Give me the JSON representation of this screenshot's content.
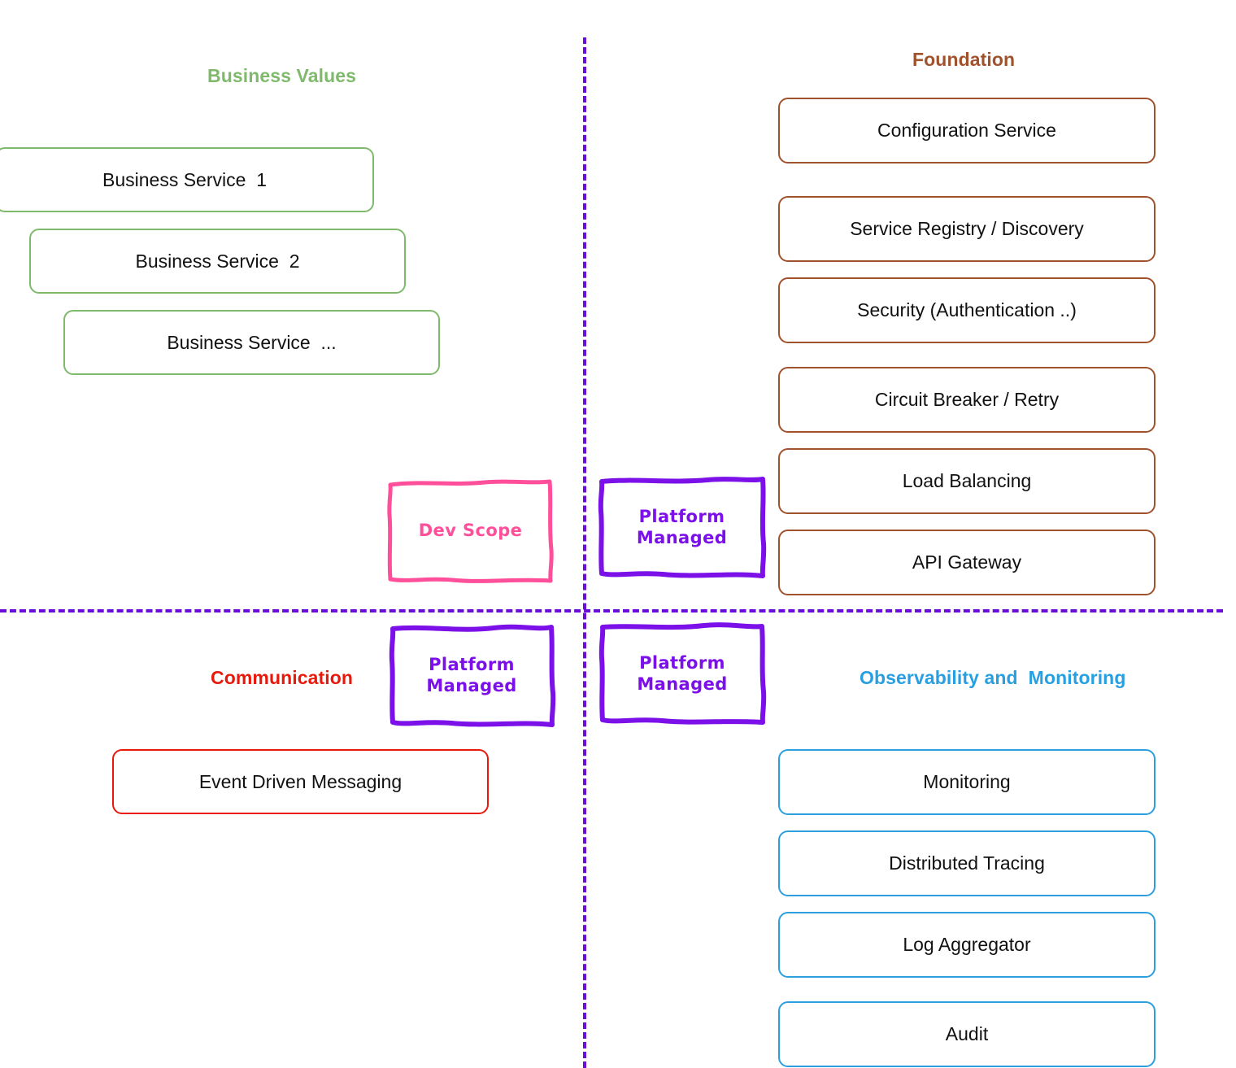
{
  "diagram": {
    "title_business_values": "Business Values",
    "title_foundation": "Foundation",
    "title_communication": "Communication",
    "title_observability": "Observability and  Monitoring",
    "colors": {
      "business_values": "#7FBA6C",
      "foundation": "#A0522D",
      "communication": "#E8180A",
      "observability": "#279FE0",
      "dev_scope": "#FF4F9A",
      "platform_managed": "#7B10E8",
      "divider": "#6A0DD8",
      "text": "#111111",
      "background": "#FFFFFF"
    }
  },
  "business_values": {
    "title": "Business Values",
    "boxes": [
      {
        "label": "Business Service  1"
      },
      {
        "label": "Business Service  2"
      },
      {
        "label": "Business Service  ..."
      }
    ]
  },
  "foundation": {
    "title": "Foundation",
    "boxes": [
      {
        "label": "Configuration Service"
      },
      {
        "label": "Service Registry / Discovery"
      },
      {
        "label": "Security (Authentication ..)"
      },
      {
        "label": "Circuit Breaker / Retry"
      },
      {
        "label": "Load Balancing"
      },
      {
        "label": "API Gateway"
      }
    ]
  },
  "communication": {
    "title": "Communication",
    "boxes": [
      {
        "label": "Event Driven Messaging"
      }
    ]
  },
  "observability": {
    "title": "Observability and  Monitoring",
    "boxes": [
      {
        "label": "Monitoring"
      },
      {
        "label": "Distributed Tracing"
      },
      {
        "label": "Log Aggregator"
      },
      {
        "label": "Audit"
      }
    ]
  },
  "annotations": {
    "dev_scope": "Dev Scope",
    "platform_managed_foundation": "Platform\nManaged",
    "platform_managed_communication": "Platform\nManaged",
    "platform_managed_observability": "Platform\nManaged"
  }
}
